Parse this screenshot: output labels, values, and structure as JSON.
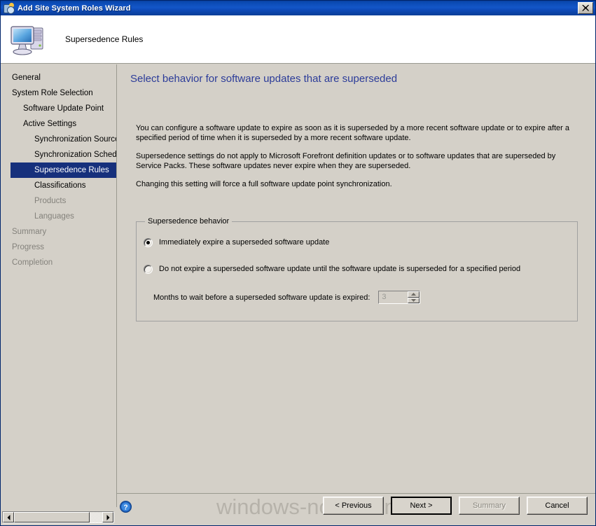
{
  "window": {
    "title": "Add Site System Roles Wizard",
    "titlebar_icon": "wizard-gear-icon",
    "close_label": "close-icon",
    "header_title": "Supersedence Rules",
    "header_icon": "computer-icon",
    "accent_color": "#2c3c99",
    "titlebar_color": "#0a48b0",
    "selection_color": "#16307c",
    "face_color": "#d4d0c8"
  },
  "sidebar": {
    "items": [
      {
        "label": "General",
        "level": 1,
        "state": "enabled"
      },
      {
        "label": "System Role Selection",
        "level": 1,
        "state": "enabled"
      },
      {
        "label": "Software Update Point",
        "level": 2,
        "state": "enabled"
      },
      {
        "label": "Active Settings",
        "level": 2,
        "state": "enabled"
      },
      {
        "label": "Synchronization Source",
        "level": 3,
        "state": "enabled"
      },
      {
        "label": "Synchronization Schedule",
        "level": 3,
        "state": "enabled"
      },
      {
        "label": "Supersedence Rules",
        "level": 3,
        "state": "selected"
      },
      {
        "label": "Classifications",
        "level": 3,
        "state": "enabled"
      },
      {
        "label": "Products",
        "level": 3,
        "state": "disabled"
      },
      {
        "label": "Languages",
        "level": 3,
        "state": "disabled"
      },
      {
        "label": "Summary",
        "level": 1,
        "state": "disabled"
      },
      {
        "label": "Progress",
        "level": 1,
        "state": "disabled"
      },
      {
        "label": "Completion",
        "level": 1,
        "state": "disabled"
      }
    ],
    "scrollbar": {
      "left_arrow": "arrow-left-icon",
      "right_arrow": "arrow-right-icon"
    }
  },
  "main": {
    "heading": "Select behavior for software updates that are superseded",
    "paragraphs": [
      "You can configure a software update to expire as soon as it is superseded by a more recent software update or to expire after a specified period of time when it is superseded by a more recent software update.",
      "Supersedence settings do not apply to Microsoft Forefront definition updates or to software updates that are superseded by Service Packs. These software updates never expire when they are superseded.",
      "Changing this setting will force a full software update point synchronization."
    ],
    "groupbox": {
      "legend": "Supersedence behavior",
      "options": [
        {
          "label": "Immediately expire a superseded software update",
          "selected": true
        },
        {
          "label": "Do not expire a superseded software update until the software update is superseded for a specified period",
          "selected": false
        }
      ],
      "months_label": "Months to wait before a superseded software update is expired:",
      "months_value": "3",
      "months_enabled": false,
      "spinner_up": "spinner-up-icon",
      "spinner_down": "spinner-down-icon"
    }
  },
  "footer": {
    "help_icon": "help-icon",
    "buttons": [
      {
        "label": "< Previous",
        "state": "enabled"
      },
      {
        "label": "Next >",
        "state": "default"
      },
      {
        "label": "Summary",
        "state": "disabled"
      },
      {
        "label": "Cancel",
        "state": "enabled"
      }
    ]
  },
  "watermark": {
    "text": "windows-noob.com"
  }
}
